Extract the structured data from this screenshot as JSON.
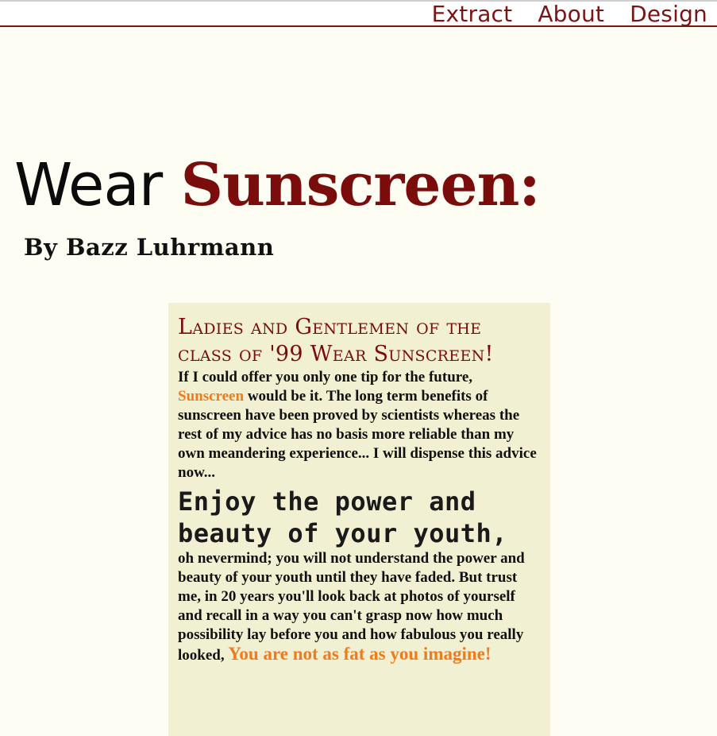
{
  "nav": {
    "items": [
      "Extract",
      "About",
      "Design"
    ]
  },
  "header": {
    "title_plain": "Wear",
    "title_accent": "Sunscreen:",
    "byline": "By Bazz Luhrmann"
  },
  "card": {
    "heading": "Ladies and Gentlemen of the class of '99 Wear Sunscreen!",
    "p1_before": "If I could offer you only one tip for the future,",
    "p1_highlight": "Sunscreen",
    "p1_after": "would be it. The long term benefits of sunscreen have been proved by scientists whereas the rest of my advice has no basis more reliable than my own meandering experience... I will dispense this advice now...",
    "subheading": "Enjoy the power and beauty of your youth,",
    "p2": "oh nevermind; you will not understand the power and beauty of your youth until they have faded. But trust me, in 20 years you'll look back at photos of yourself and recall in a way you can't grasp now how much possibility lay before you and how fabulous you really looked,",
    "p2_highlight": "You are not as fat as you imagine!"
  },
  "colors": {
    "accent": "#7a0c0c",
    "highlight": "#f07a1e",
    "card_bg": "#f1f0d3",
    "page_bg": "#fdfdf3"
  }
}
